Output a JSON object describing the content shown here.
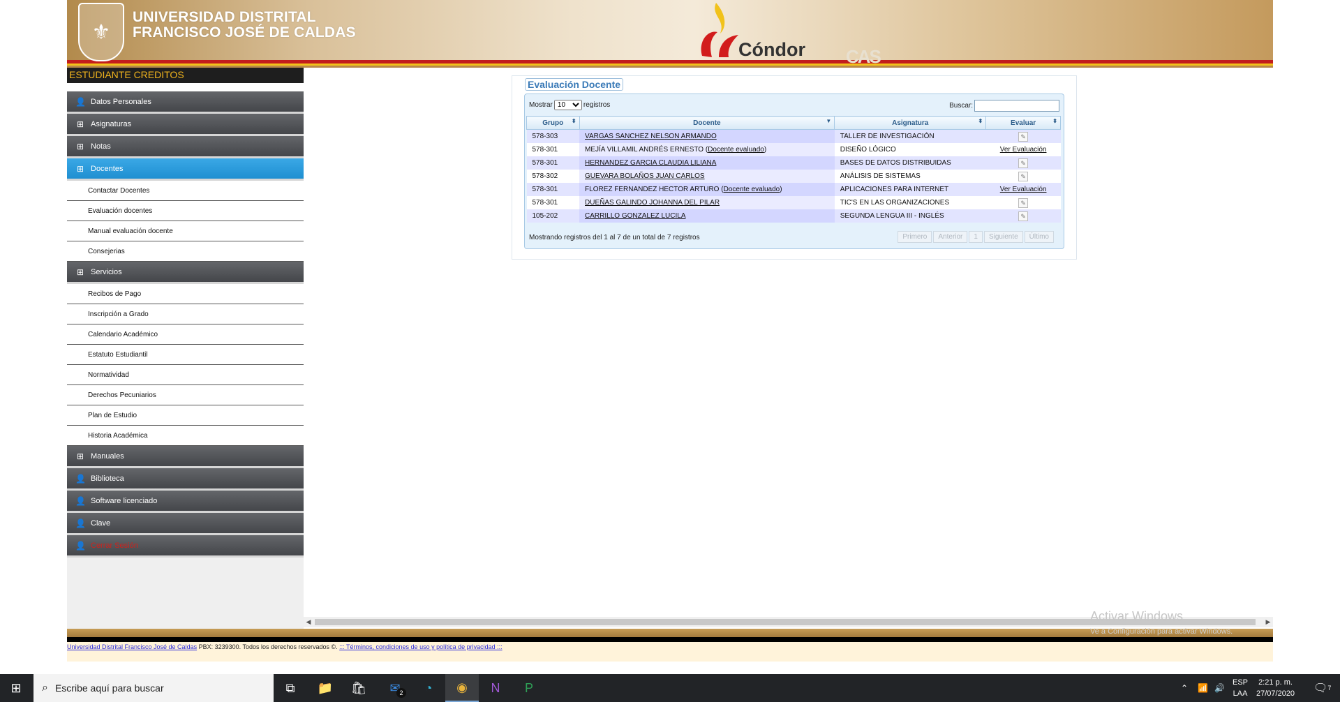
{
  "header": {
    "university_line1": "UNIVERSIDAD DISTRITAL",
    "university_line2": "FRANCISCO JOSÉ DE CALDAS",
    "logo_text": "Cóndor",
    "cas_text": "CAS"
  },
  "sidebar": {
    "title": "ESTUDIANTE CREDITOS",
    "menus": [
      {
        "label": "Datos Personales",
        "icon": "user-icon"
      },
      {
        "label": "Asignaturas",
        "icon": "tree-icon"
      },
      {
        "label": "Notas",
        "icon": "tree-icon"
      },
      {
        "label": "Docentes",
        "icon": "tree-icon",
        "active": true,
        "items": [
          "Contactar Docentes",
          "Evaluación docentes",
          "Manual evaluación docente",
          "Consejerias"
        ]
      },
      {
        "label": "Servicios",
        "icon": "tree-icon",
        "items": [
          "Recibos de Pago",
          "Inscripción a Grado",
          "Calendario Académico",
          "Estatuto Estudiantil",
          "Normatividad",
          "Derechos Pecuniarios",
          "Plan de Estudio",
          "Historia Académica"
        ]
      },
      {
        "label": "Manuales",
        "icon": "tree-icon"
      },
      {
        "label": "Biblioteca",
        "icon": "user-icon"
      },
      {
        "label": "Software licenciado",
        "icon": "user-icon"
      },
      {
        "label": "Clave",
        "icon": "user-icon"
      },
      {
        "label": "Cerrar Sesión",
        "icon": "user-icon"
      }
    ]
  },
  "evaluation": {
    "legend": "Evaluación Docente",
    "show_label": "Mostrar",
    "show_value": "10",
    "records_label": "registros",
    "search_label": "Buscar:",
    "search_value": "",
    "columns": [
      "Grupo",
      "Docente",
      "Asignatura",
      "Evaluar"
    ],
    "rows": [
      {
        "grupo": "578-303",
        "docente": "VARGAS SANCHEZ NELSON ARMANDO",
        "evaluado": "",
        "asignatura": "TALLER DE INVESTIGACIÓN",
        "evaluar": ""
      },
      {
        "grupo": "578-301",
        "docente": "MEJÍA VILLAMIL ANDRÉS ERNESTO",
        "evaluado": "Docente evaluado",
        "asignatura": "DISEÑO LÓGICO",
        "evaluar": "Ver Evaluación"
      },
      {
        "grupo": "578-301",
        "docente": "HERNANDEZ GARCIA CLAUDIA LILIANA",
        "evaluado": "",
        "asignatura": "BASES DE DATOS DISTRIBUIDAS",
        "evaluar": ""
      },
      {
        "grupo": "578-302",
        "docente": "GUEVARA BOLAÑOS JUAN CARLOS",
        "evaluado": "",
        "asignatura": "ANÁLISIS DE SISTEMAS",
        "evaluar": ""
      },
      {
        "grupo": "578-301",
        "docente": "FLOREZ FERNANDEZ HECTOR ARTURO",
        "evaluado": "Docente evaluado",
        "asignatura": "APLICACIONES PARA INTERNET",
        "evaluar": "Ver Evaluación"
      },
      {
        "grupo": "578-301",
        "docente": "DUEÑAS GALINDO JOHANNA DEL PILAR",
        "evaluado": "",
        "asignatura": "TIC'S EN LAS ORGANIZACIONES",
        "evaluar": ""
      },
      {
        "grupo": "105-202",
        "docente": "CARRILLO GONZALEZ LUCILA",
        "evaluado": "",
        "asignatura": "SEGUNDA LENGUA III - INGLÉS",
        "evaluar": ""
      }
    ],
    "info": "Mostrando registros del 1 al 7 de un total de 7 registros",
    "pager": [
      "Primero",
      "Anterior",
      "1",
      "Siguiente",
      "Último"
    ]
  },
  "footer": {
    "link1": "Universidad Distrital Francisco José de Caldas",
    "text": " PBX: 3239300. Todos los derechos reservados ©. ",
    "link2": "::: Términos, condiciones de uso y política de privacidad :::"
  },
  "watermark": {
    "line1": "Activar Windows",
    "line2": "Ve a Configuración para activar Windows."
  },
  "taskbar": {
    "search_placeholder": "Escribe aquí para buscar",
    "lang1": "ESP",
    "lang2": "LAA",
    "time": "2:21 p. m.",
    "date": "27/07/2020",
    "mail_badge": "2",
    "notif_badge": "7"
  }
}
